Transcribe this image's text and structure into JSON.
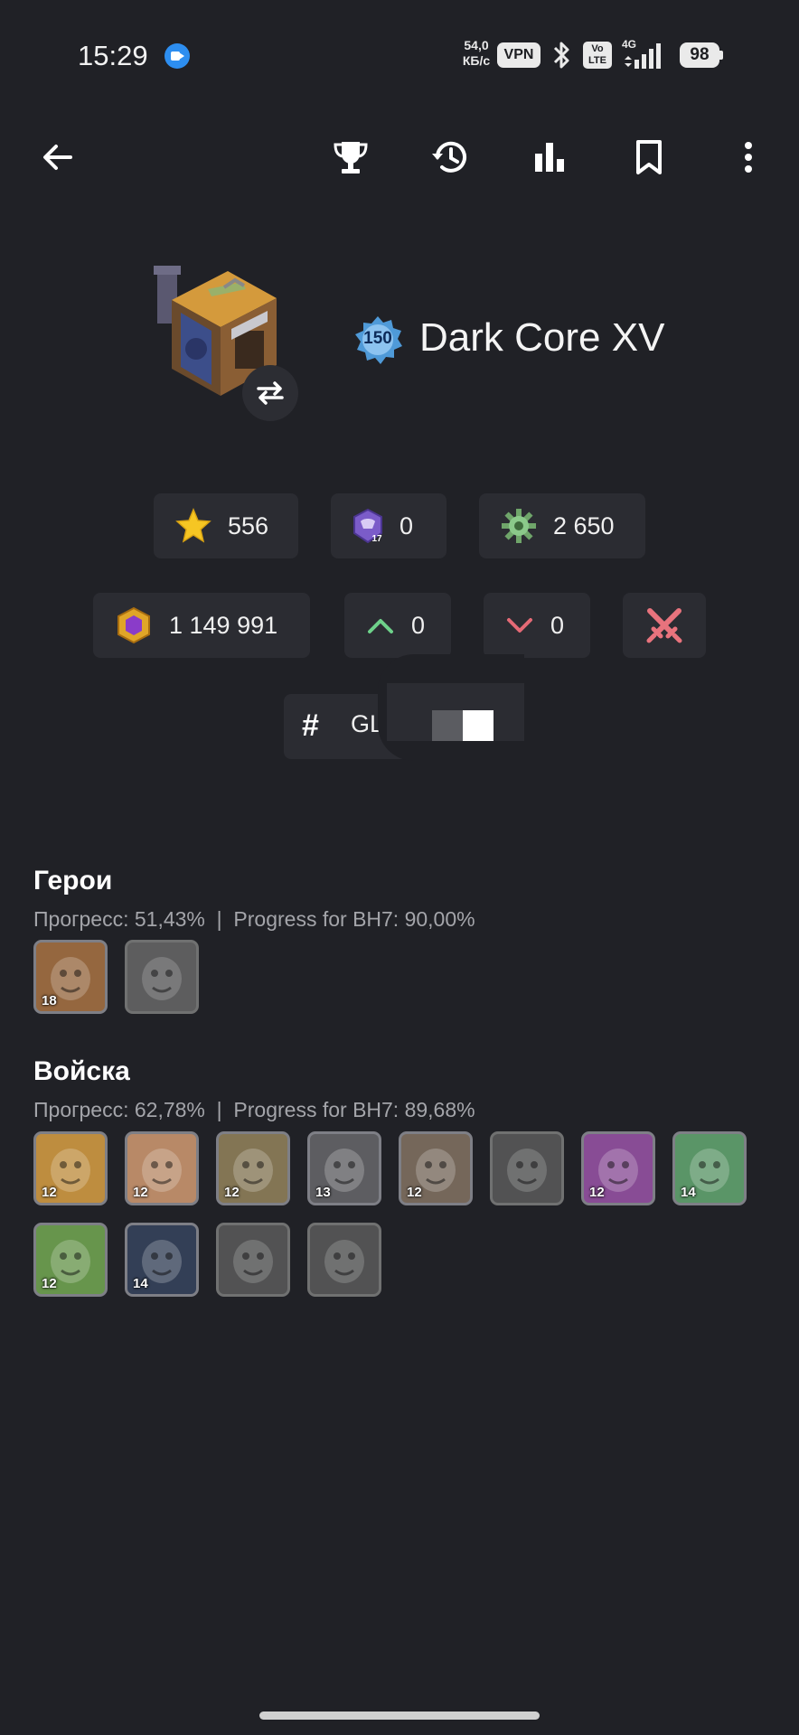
{
  "status_bar": {
    "time": "15:29",
    "speed_value": "54,0",
    "speed_unit": "КБ/с",
    "vpn": "VPN",
    "volte_top": "Vo",
    "volte_bottom": "LTE",
    "network": "4G",
    "battery": "98"
  },
  "app_bar": {
    "back_icon": "arrow-left-icon",
    "actions": [
      "trophy-icon",
      "history-icon",
      "bar-chart-icon",
      "bookmark-icon",
      "more-vert-icon"
    ]
  },
  "profile": {
    "level": "150",
    "name": "Dark Core XV"
  },
  "stats_row1": {
    "stars": "556",
    "league_badge_number": "17",
    "league_value": "0",
    "gear_value": "2 650"
  },
  "stats_row2": {
    "elixir_value": "1 149 991",
    "up_value": "0",
    "down_value": "0"
  },
  "tag": {
    "hash": "#",
    "text": "GL"
  },
  "heroes": {
    "title": "Герои",
    "progress": "Прогресс: 51,43%  |  Progress for BH7: 90,00%",
    "items": [
      {
        "name": "battle-machine",
        "level": "18",
        "color": "#b07a4a",
        "locked": false
      },
      {
        "name": "battle-copter",
        "level": "",
        "color": "#7a7b80",
        "locked": true
      }
    ]
  },
  "troops": {
    "title": "Войска",
    "progress": "Прогресс: 62,78%  |  Progress for BH7: 89,68%",
    "items": [
      {
        "name": "raged-barbarian",
        "level": "12",
        "color": "#e0a64a",
        "locked": false
      },
      {
        "name": "sneaky-archer",
        "level": "12",
        "color": "#d9a27a",
        "locked": false
      },
      {
        "name": "boxer-giant",
        "level": "12",
        "color": "#9a8a63",
        "locked": false
      },
      {
        "name": "cannon-cart",
        "level": "13",
        "color": "#6e6e72",
        "locked": false
      },
      {
        "name": "bomber",
        "level": "12",
        "color": "#8a7a6a",
        "locked": false
      },
      {
        "name": "beta-minion",
        "level": "",
        "color": "#6a6b70",
        "locked": true
      },
      {
        "name": "archer",
        "level": "12",
        "color": "#a05ab0",
        "locked": false
      },
      {
        "name": "baby-dragon",
        "level": "14",
        "color": "#6ab07a",
        "locked": false
      },
      {
        "name": "hog-glider",
        "level": "12",
        "color": "#7ab05a",
        "locked": false
      },
      {
        "name": "night-witch",
        "level": "14",
        "color": "#3c4a66",
        "locked": false
      },
      {
        "name": "drop-ship",
        "level": "",
        "color": "#6a6b70",
        "locked": true
      },
      {
        "name": "super-pekka",
        "level": "",
        "color": "#6a6b70",
        "locked": true
      }
    ]
  }
}
